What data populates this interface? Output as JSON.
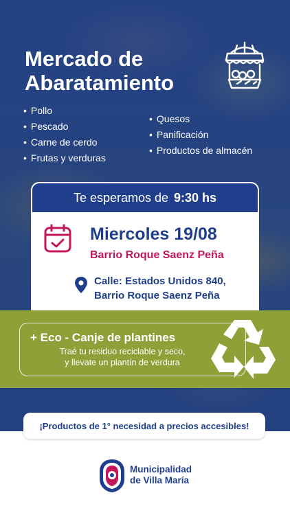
{
  "header": {
    "title_line1": "Mercado de",
    "title_line2": "Abaratamiento",
    "logo_icon": "market-stall-icon"
  },
  "products": {
    "left": [
      "Pollo",
      "Pescado",
      "Carne de cerdo",
      "Frutas y verduras"
    ],
    "right": [
      "Quesos",
      "Panificación",
      "Productos de almacén"
    ]
  },
  "schedule": {
    "prefix": "Te esperamos de",
    "time": "9:30 hs"
  },
  "event": {
    "date": "Miercoles 19/08",
    "neighborhood": "Barrio Roque Saenz Peña",
    "address_line1": "Calle: Estados Unidos 840,",
    "address_line2": "Barrio Roque Saenz Peña",
    "calendar_icon": "calendar-check-icon",
    "location_icon": "map-pin-icon"
  },
  "eco": {
    "title": "+  Eco - Canje de plantines",
    "desc_line1": "Traé tu residuo reciclable y seco,",
    "desc_line2": "y llevate un plantín de verdura",
    "icon": "recycle-icon"
  },
  "slogan": "¡Productos de 1° necesidad a precios accesibles!",
  "footer": {
    "name_line1": "Municipalidad",
    "name_line2": "de Villa María",
    "logo_icon": "municipality-seal-icon"
  },
  "colors": {
    "brand_blue": "#1f3f8c",
    "accent_magenta": "#c4175a",
    "eco_green": "#8ea037"
  }
}
